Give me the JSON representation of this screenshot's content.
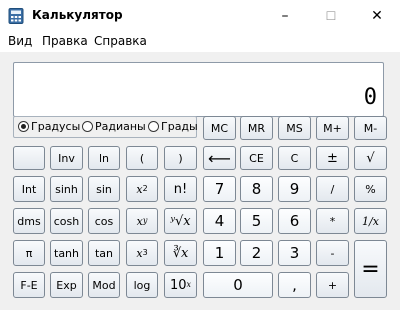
{
  "window": {
    "title": "Калькулятор",
    "minimize": "–",
    "maximize": "☐",
    "close": "✕"
  },
  "menu": {
    "view": "Вид",
    "edit": "Правка",
    "help": "Справка"
  },
  "display": {
    "value": "0"
  },
  "angle_units": {
    "degrees": "Градусы",
    "radians": "Радианы",
    "grads": "Грады",
    "selected": "degrees"
  },
  "buttons": {
    "mc": "MC",
    "mr": "MR",
    "ms": "MS",
    "mplus": "M+",
    "mminus": "M-",
    "inv": "Inv",
    "ln": "ln",
    "lparen": "(",
    "rparen": ")",
    "backspace": "⟵",
    "ce": "CE",
    "c": "C",
    "plusminus": "±",
    "sqrt": "√",
    "int": "Int",
    "sinh": "sinh",
    "sin": "sin",
    "x2_base": "x",
    "x2_exp": "2",
    "factorial": "n!",
    "n7": "7",
    "n8": "8",
    "n9": "9",
    "div": "/",
    "percent": "%",
    "dms": "dms",
    "cosh": "cosh",
    "cos": "cos",
    "xy_base": "x",
    "xy_exp": "y",
    "yroot": "ʸ√x",
    "n4": "4",
    "n5": "5",
    "n6": "6",
    "mul": "*",
    "recip": "1/x",
    "pi": "π",
    "tanh": "tanh",
    "tan": "tan",
    "x3_base": "x",
    "x3_exp": "3",
    "cuberoot": "∛x",
    "n1": "1",
    "n2": "2",
    "n3": "3",
    "sub": "-",
    "eq": "=",
    "fe": "F-E",
    "exp": "Exp",
    "mod": "Mod",
    "log": "log",
    "tenx_base": "10",
    "tenx_exp": "x",
    "n0": "0",
    "dot": ",",
    "add": "+"
  }
}
